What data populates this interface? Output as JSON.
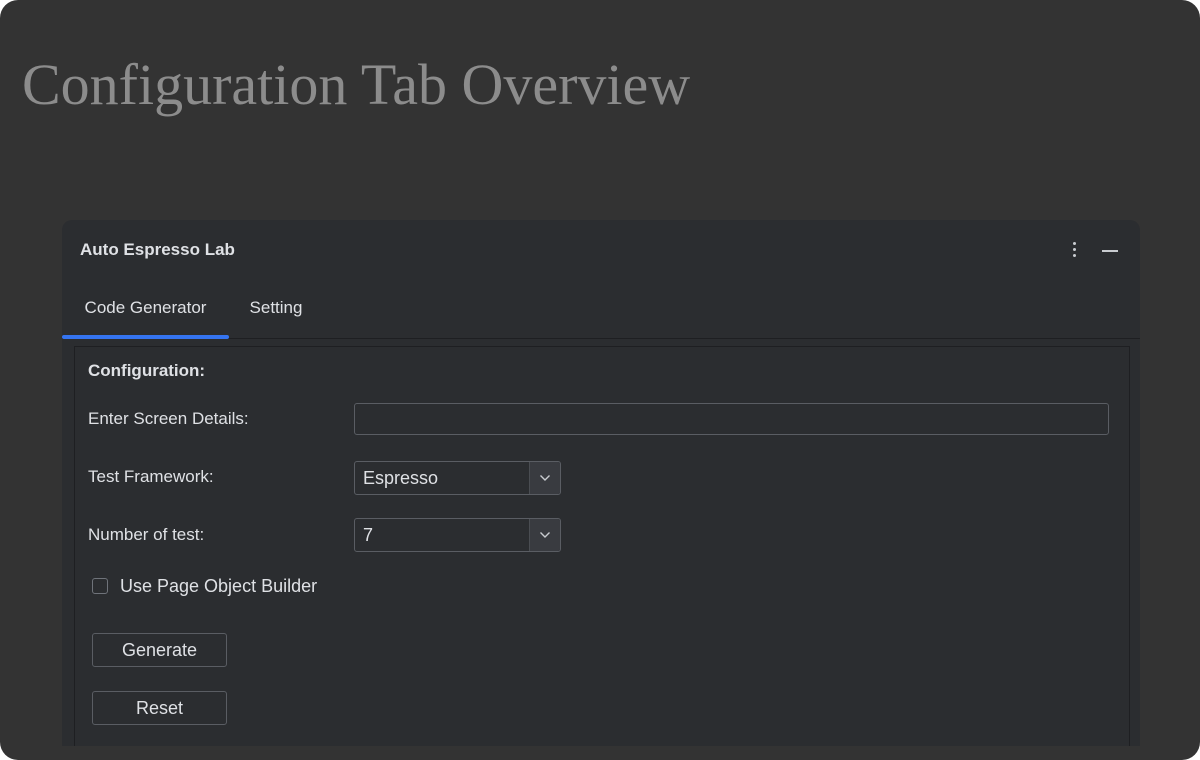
{
  "page": {
    "heading": "Configuration Tab Overview"
  },
  "tool_window": {
    "title": "Auto Espresso Lab",
    "options_icon": "kebab-vertical-icon",
    "minimize_icon": "minimize-icon",
    "accent_color": "#3574f0",
    "tabs": [
      {
        "label": "Code Generator",
        "selected": true
      },
      {
        "label": "Setting",
        "selected": false
      }
    ]
  },
  "configuration": {
    "section_title": "Configuration:",
    "screen_details": {
      "label": "Enter Screen Details:",
      "value": "",
      "placeholder": ""
    },
    "test_framework": {
      "label": "Test Framework:",
      "selected": "Espresso"
    },
    "number_of_test": {
      "label": "Number of test:",
      "selected": "7"
    },
    "page_object_builder": {
      "label": "Use Page Object Builder",
      "checked": false
    },
    "buttons": {
      "generate": "Generate",
      "reset": "Reset"
    }
  }
}
